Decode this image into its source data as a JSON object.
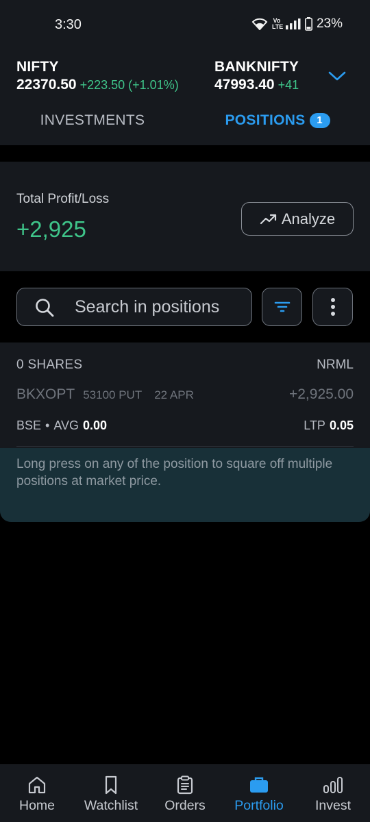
{
  "status_bar": {
    "time": "3:30",
    "volte": "Vo LTE",
    "battery": "23%"
  },
  "indices": [
    {
      "name": "NIFTY",
      "value": "22370.50",
      "change": "+223.50 (+1.01%)"
    },
    {
      "name": "BANKNIFTY",
      "value": "47993.40",
      "change": "+41"
    }
  ],
  "tabs": {
    "investments": "INVESTMENTS",
    "positions": "POSITIONS",
    "positions_badge": "1"
  },
  "summary": {
    "label": "Total Profit/Loss",
    "value": "+2,925",
    "analyze_label": "Analyze"
  },
  "search": {
    "placeholder": "Search in positions"
  },
  "position": {
    "shares": "0 SHARES",
    "product": "NRML",
    "symbol": "BKXOPT",
    "strike": "53100 PUT",
    "expiry": "22 APR",
    "pnl": "+2,925.00",
    "exchange": "BSE",
    "dot": "•",
    "avg_label": "AVG",
    "avg_value": "0.00",
    "ltp_label": "LTP",
    "ltp_value": "0.05"
  },
  "hint": "Long press on any of the position to square off multiple positions at market price.",
  "bottom_nav": [
    {
      "label": "Home",
      "icon": "home-icon"
    },
    {
      "label": "Watchlist",
      "icon": "bookmark-icon"
    },
    {
      "label": "Orders",
      "icon": "clipboard-icon"
    },
    {
      "label": "Portfolio",
      "icon": "briefcase-icon"
    },
    {
      "label": "Invest",
      "icon": "bar-chart-icon"
    }
  ],
  "colors": {
    "accent": "#2b9cf0",
    "profit": "#3fc58a",
    "surface": "#16191e",
    "background": "#000000",
    "hint_bg": "#183038"
  }
}
